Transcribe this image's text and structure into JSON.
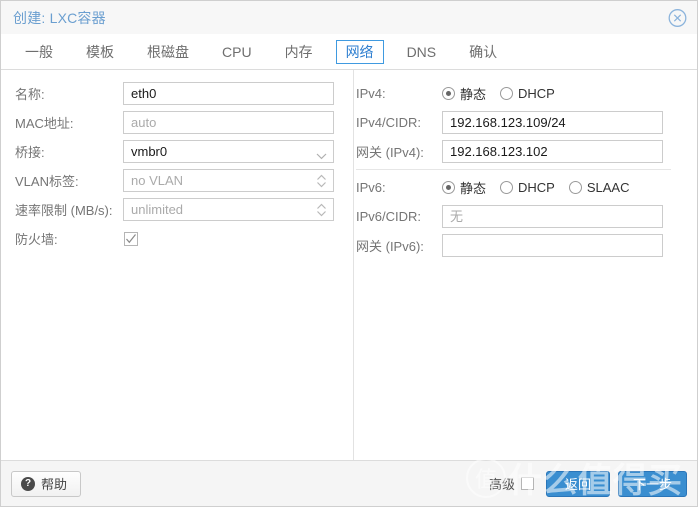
{
  "window": {
    "title": "创建: LXC容器",
    "close_icon": "close-circle-icon"
  },
  "tabs": [
    {
      "label": "一般",
      "active": false
    },
    {
      "label": "模板",
      "active": false
    },
    {
      "label": "根磁盘",
      "active": false
    },
    {
      "label": "CPU",
      "active": false
    },
    {
      "label": "内存",
      "active": false
    },
    {
      "label": "网络",
      "active": true
    },
    {
      "label": "DNS",
      "active": false
    },
    {
      "label": "确认",
      "active": false
    }
  ],
  "form": {
    "left": {
      "name": {
        "label": "名称:",
        "value": "eth0",
        "is_placeholder": false
      },
      "mac": {
        "label": "MAC地址:",
        "value": "auto",
        "is_placeholder": true
      },
      "bridge": {
        "label": "桥接:",
        "value": "vmbr0",
        "is_placeholder": false
      },
      "vlan": {
        "label": "VLAN标签:",
        "value": "no VLAN",
        "is_placeholder": true
      },
      "rate": {
        "label": "速率限制 (MB/s):",
        "value": "unlimited",
        "is_placeholder": true
      },
      "firewall": {
        "label": "防火墙:",
        "checked": true
      }
    },
    "right": {
      "ipv4_mode": {
        "label": "IPv4:",
        "options": [
          "静态",
          "DHCP"
        ],
        "selected": "静态"
      },
      "ipv4_cidr": {
        "label": "IPv4/CIDR:",
        "value": "192.168.123.109/24",
        "is_placeholder": false
      },
      "ipv4_gw": {
        "label": "网关 (IPv4):",
        "value": "192.168.123.102",
        "is_placeholder": false
      },
      "ipv6_mode": {
        "label": "IPv6:",
        "options": [
          "静态",
          "DHCP",
          "SLAAC"
        ],
        "selected": "静态"
      },
      "ipv6_cidr": {
        "label": "IPv6/CIDR:",
        "value": "无",
        "is_placeholder": true
      },
      "ipv6_gw": {
        "label": "网关 (IPv6):",
        "value": "",
        "is_placeholder": false
      }
    }
  },
  "footer": {
    "help_label": "帮助",
    "help_icon": "question-mark-icon",
    "advanced_label": "高级",
    "advanced_checked": false,
    "back_label": "返回",
    "next_label": "下一步"
  },
  "watermark": {
    "badge": "值",
    "text": "什么值得买"
  },
  "colors": {
    "accent": "#3a8ed0",
    "tab_active_border": "#3f9ae0",
    "title": "#6b9fd0",
    "label": "#757575",
    "field_border": "#cccccc",
    "placeholder": "#aaaaaa"
  }
}
